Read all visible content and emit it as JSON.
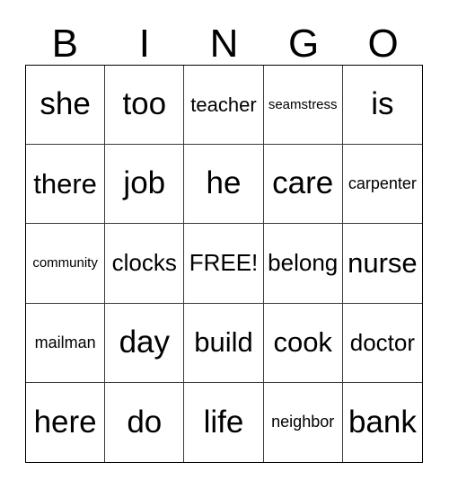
{
  "card": {
    "title": "BINGO",
    "header_letters": [
      "B",
      "I",
      "N",
      "G",
      "O"
    ],
    "columns": 5,
    "rows": 5,
    "free_space_label": "FREE!",
    "free_space_position": {
      "row": 3,
      "column": 3
    },
    "colors": {
      "background": "#ffffff",
      "text": "#000000",
      "grid_line": "#3a3a3a",
      "outer_border": "#000000"
    },
    "grid": [
      [
        {
          "text": "she",
          "size": "xl"
        },
        {
          "text": "too",
          "size": "xl"
        },
        {
          "text": "teacher",
          "size": "sm"
        },
        {
          "text": "seamstress",
          "size": "xxs"
        },
        {
          "text": "is",
          "size": "xl"
        }
      ],
      [
        {
          "text": "there",
          "size": "lg"
        },
        {
          "text": "job",
          "size": "xl"
        },
        {
          "text": "he",
          "size": "xl"
        },
        {
          "text": "care",
          "size": "xl"
        },
        {
          "text": "carpenter",
          "size": "xs"
        }
      ],
      [
        {
          "text": "community",
          "size": "xxs"
        },
        {
          "text": "clocks",
          "size": "md"
        },
        {
          "text": "FREE!",
          "size": "md"
        },
        {
          "text": "belong",
          "size": "md"
        },
        {
          "text": "nurse",
          "size": "lg"
        }
      ],
      [
        {
          "text": "mailman",
          "size": "xs"
        },
        {
          "text": "day",
          "size": "xl"
        },
        {
          "text": "build",
          "size": "lg"
        },
        {
          "text": "cook",
          "size": "lg"
        },
        {
          "text": "doctor",
          "size": "md"
        }
      ],
      [
        {
          "text": "here",
          "size": "xl"
        },
        {
          "text": "do",
          "size": "xl"
        },
        {
          "text": "life",
          "size": "xl"
        },
        {
          "text": "neighbor",
          "size": "xs"
        },
        {
          "text": "bank",
          "size": "xl"
        }
      ]
    ]
  }
}
